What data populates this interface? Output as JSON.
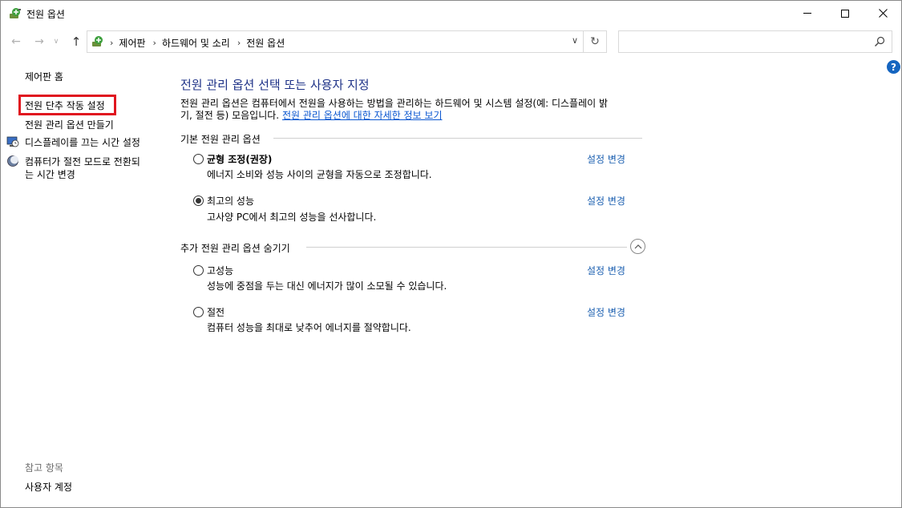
{
  "window": {
    "title": "전원 옵션",
    "icon": "power-options-icon"
  },
  "address": {
    "crumbs": [
      "제어판",
      "하드웨어 및 소리",
      "전원 옵션"
    ],
    "search_placeholder": ""
  },
  "left": {
    "home": "제어판 홈",
    "items": [
      {
        "label": "전원 단추 작동 설정",
        "highlighted": true
      },
      {
        "label": "전원 관리 옵션 만들기"
      },
      {
        "label": "디스플레이를 끄는 시간 설정",
        "icon": "display-clock-icon"
      },
      {
        "label_line1": "컴퓨터가 절전 모드로 전환되",
        "label_line2": "는 시간 변경",
        "icon": "moon-icon"
      }
    ],
    "see_also_title": "참고 항목",
    "see_also_items": [
      "사용자 계정"
    ]
  },
  "main": {
    "heading": "전원 관리 옵션 선택 또는 사용자 지정",
    "description_line1": "전원 관리 옵션은 컴퓨터에서 전원을 사용하는 방법을 관리하는 하드웨어 및 시스템 설정(예: 디스플레이 밝",
    "description_line2_prefix": "기, 절전 등) 모음입니다.",
    "description_link": "전원 관리 옵션에 대한 자세한 정보 보기",
    "basic_group_title": "기본 전원 관리 옵션",
    "extra_group_title": "추가 전원 관리 옵션 숨기기",
    "change_label": "설정 변경",
    "plans": [
      {
        "name": "균형 조정(권장)",
        "desc": "에너지 소비와 성능 사이의 균형을 자동으로 조정합니다.",
        "selected": false
      },
      {
        "name": "최고의 성능",
        "desc": "고사양 PC에서 최고의 성능을 선사합니다.",
        "selected": true
      },
      {
        "name": "고성능",
        "desc": "성능에 중점을 두는 대신 에너지가 많이 소모될 수 있습니다.",
        "selected": false
      },
      {
        "name": "절전",
        "desc": "컴퓨터 성능을 최대로 낮추어 에너지를 절약합니다.",
        "selected": false
      }
    ]
  },
  "colors": {
    "heading": "#1e3287",
    "link": "#1b5fb0",
    "highlight_border": "#e0151f",
    "help": "#1565c0"
  }
}
